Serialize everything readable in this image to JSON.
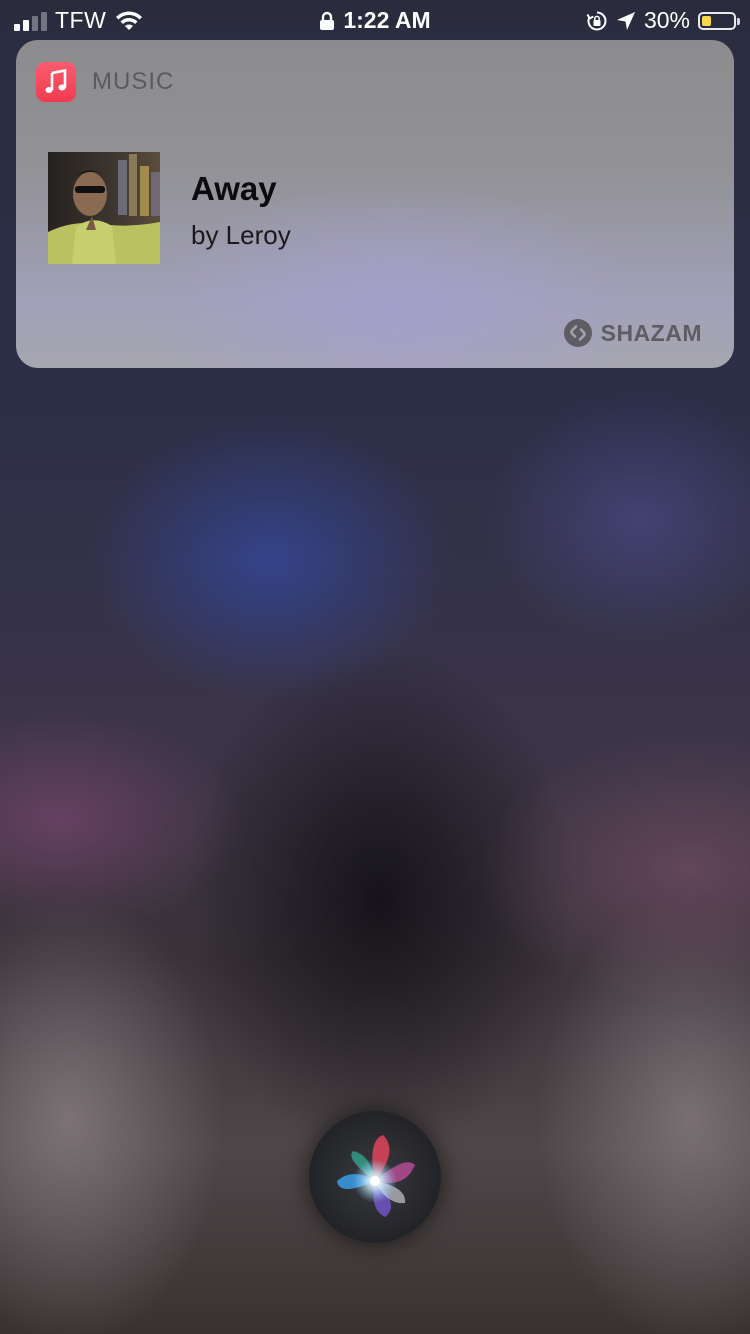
{
  "status_bar": {
    "carrier": "TFW",
    "time": "1:22 AM",
    "battery_percent": "30%",
    "battery_level": 0.3,
    "signal_bars_filled": 2,
    "signal_bars_total": 4,
    "icons": [
      "signal-icon",
      "wifi-icon",
      "lock-icon",
      "orientation-lock-icon",
      "location-arrow-icon",
      "battery-icon"
    ],
    "battery_color": "#f7d84a"
  },
  "siri_card": {
    "app_label": "MUSIC",
    "app_icon": "music-note-icon",
    "app_icon_color": "#f03b4f",
    "song": {
      "title": "Away",
      "artist_line": "by Leroy"
    },
    "attribution": "SHAZAM",
    "attribution_icon": "shazam-logo-icon"
  },
  "siri_orb": {
    "icon": "siri-orb-icon"
  }
}
